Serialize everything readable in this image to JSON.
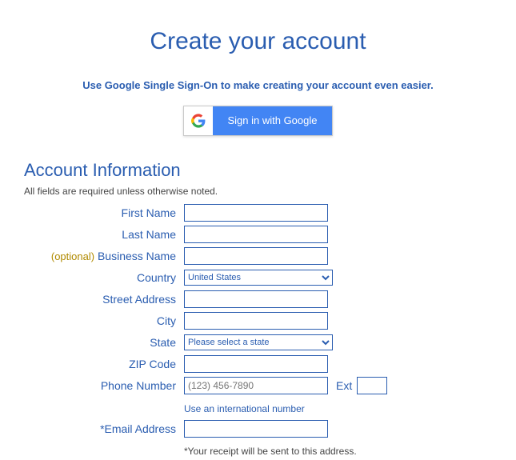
{
  "page_title": "Create your account",
  "sso_hint": "Use Google Single Sign-On to make creating your account even easier.",
  "google_button": {
    "label": "Sign in with Google"
  },
  "section_heading": "Account Information",
  "required_note": "All fields are required unless otherwise noted.",
  "labels": {
    "first_name": "First Name",
    "last_name": "Last Name",
    "optional": "(optional)",
    "business_name": "Business Name",
    "country": "Country",
    "street_address": "Street Address",
    "city": "City",
    "state": "State",
    "zip": "ZIP Code",
    "phone": "Phone Number",
    "ext": "Ext",
    "email": "*Email Address",
    "intl_link": "Use an international number"
  },
  "values": {
    "first_name": "",
    "last_name": "",
    "business_name": "",
    "country": "United States",
    "street_address": "",
    "city": "",
    "state": "Please select a state",
    "zip": "",
    "phone": "",
    "phone_placeholder": "(123) 456-7890",
    "ext": "",
    "email": ""
  },
  "receipt_note": "*Your receipt will be sent to this address."
}
